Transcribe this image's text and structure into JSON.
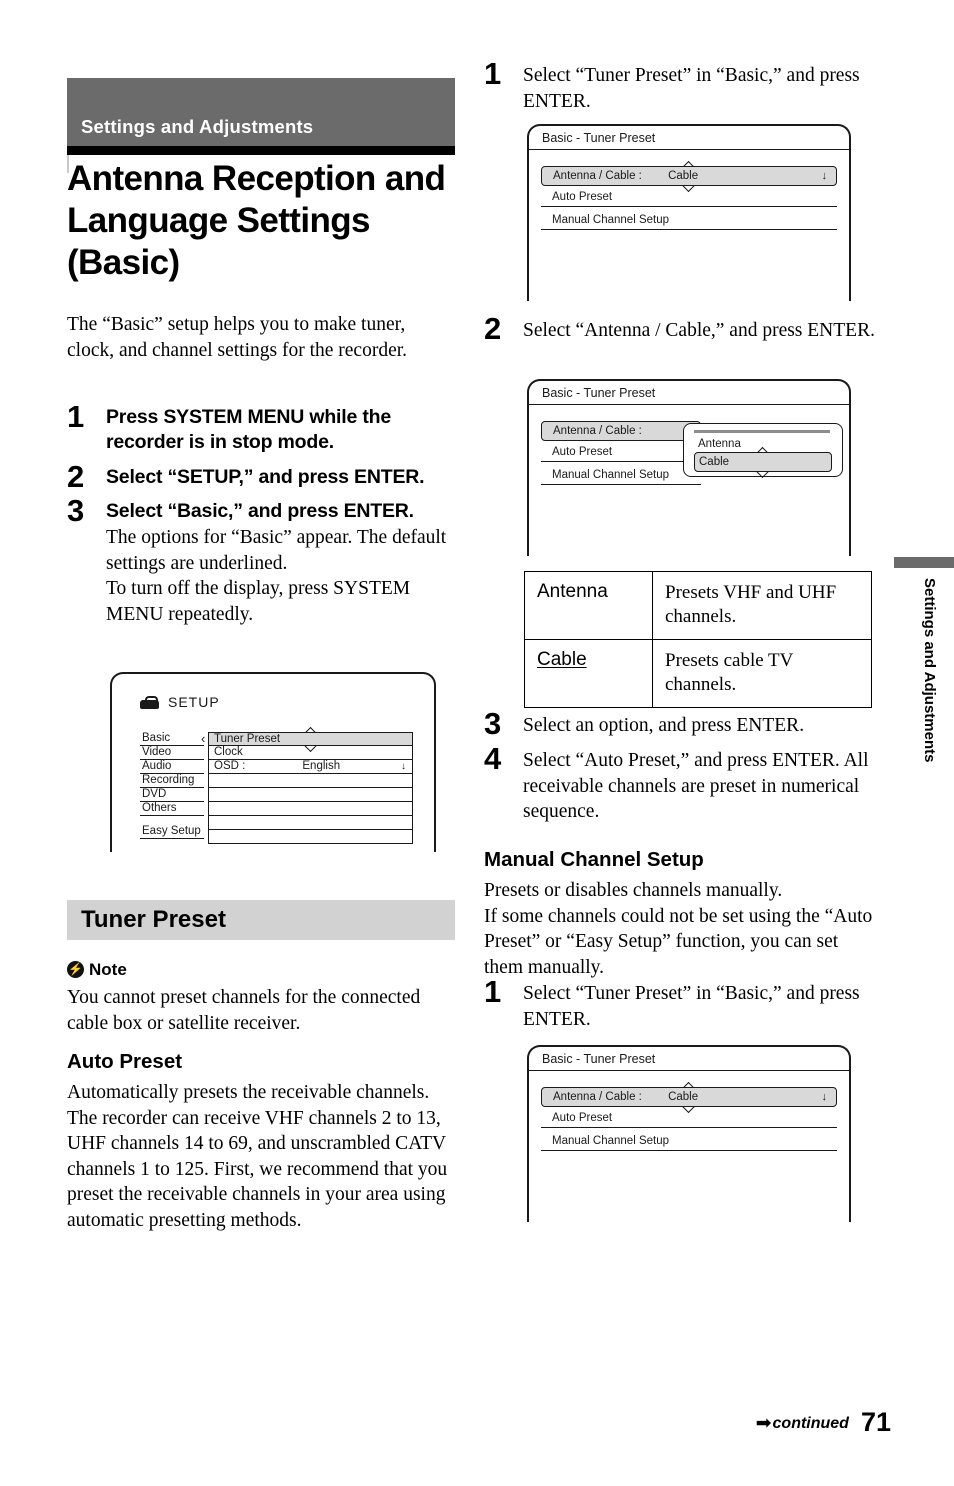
{
  "header": {
    "chapter": "Settings and Adjustments",
    "title": "Antenna Reception and Language Settings (Basic)"
  },
  "side_tab": {
    "label": "Settings and Adjustments"
  },
  "footer": {
    "continued": "continued",
    "arrow": "➡",
    "page": "71"
  },
  "left_column": {
    "intro": "The “Basic” setup helps you to make tuner, clock, and channel settings for the recorder.",
    "steps": [
      {
        "num": "1",
        "head": "Press SYSTEM MENU while the recorder is in stop mode.",
        "sub": ""
      },
      {
        "num": "2",
        "head": "Select “SETUP,” and press ENTER.",
        "sub": ""
      },
      {
        "num": "3",
        "head": "Select “Basic,” and press ENTER.",
        "sub": "The options for “Basic” appear. The default settings are underlined.\nTo turn off the display, press SYSTEM MENU repeatedly."
      }
    ],
    "setup_screen": {
      "icon": "toolbox-icon",
      "heading": "SETUP",
      "menu_items": [
        "Basic",
        "Video",
        "Audio",
        "Recording",
        "DVD",
        "Others"
      ],
      "menu_item_last": "Easy Setup",
      "options": [
        {
          "label": "Tuner Preset",
          "value": "",
          "selected": true,
          "arrow": ""
        },
        {
          "label": "Clock",
          "value": "",
          "selected": false,
          "arrow": ""
        },
        {
          "label": "OSD :",
          "value": "English",
          "selected": false,
          "arrow": "↓"
        }
      ],
      "chevron": "‹"
    },
    "tuner_preset": {
      "section_title": "Tuner Preset",
      "note_label": "Note",
      "note_text": "You cannot preset channels for the connected cable box or satellite receiver.",
      "auto_preset_title": "Auto Preset",
      "auto_preset_text": "Automatically presets the receivable channels. The recorder can receive VHF channels 2 to 13, UHF channels 14 to 69, and unscrambled CATV channels 1 to 125. First, we recommend that you preset the receivable channels in your area using automatic presetting methods."
    }
  },
  "right_column": {
    "step1": {
      "num": "1",
      "text": "Select “Tuner Preset” in “Basic,” and press ENTER."
    },
    "screen1": {
      "title": "Basic - Tuner Preset",
      "rows": [
        {
          "label": "Antenna / Cable :",
          "value": "Cable",
          "selected": true,
          "arrow": "↓"
        },
        {
          "label": "Auto Preset",
          "value": "",
          "selected": false,
          "arrow": ""
        },
        {
          "label": "Manual Channel Setup",
          "value": "",
          "selected": false,
          "arrow": ""
        }
      ]
    },
    "step2": {
      "num": "2",
      "text": "Select “Antenna / Cable,” and press ENTER."
    },
    "screen2": {
      "title": "Basic - Tuner Preset",
      "rows": [
        {
          "label": "Antenna / Cable :",
          "value": "",
          "selected": true,
          "arrow": ""
        },
        {
          "label": "Auto Preset",
          "value": "",
          "selected": false,
          "arrow": ""
        },
        {
          "label": "Manual Channel Setup",
          "value": "",
          "selected": false,
          "arrow": ""
        }
      ],
      "popup_options": [
        {
          "label": "Antenna",
          "selected": false
        },
        {
          "label": "Cable",
          "selected": true
        }
      ]
    },
    "option_table": {
      "rows": [
        {
          "option": "Antenna",
          "underlined": false,
          "description": "Presets VHF and UHF channels."
        },
        {
          "option": "Cable",
          "underlined": true,
          "description": "Presets cable TV channels."
        }
      ]
    },
    "step3": {
      "num": "3",
      "text": "Select an option, and press ENTER."
    },
    "step4": {
      "num": "4",
      "text": "Select “Auto Preset,” and press ENTER. All receivable channels are preset in numerical sequence."
    },
    "manual_channel_setup": {
      "title": "Manual Channel Setup",
      "text": "Presets or disables channels manually.\nIf some channels could not be set using the “Auto Preset” or “Easy Setup” function, you can set them manually."
    },
    "step1b": {
      "num": "1",
      "text": "Select “Tuner Preset” in “Basic,” and press ENTER."
    },
    "screen3": {
      "title": "Basic - Tuner Preset",
      "rows": [
        {
          "label": "Antenna / Cable :",
          "value": "Cable",
          "selected": true,
          "arrow": "↓"
        },
        {
          "label": "Auto Preset",
          "value": "",
          "selected": false,
          "arrow": ""
        },
        {
          "label": "Manual Channel Setup",
          "value": "",
          "selected": false,
          "arrow": ""
        }
      ]
    }
  }
}
